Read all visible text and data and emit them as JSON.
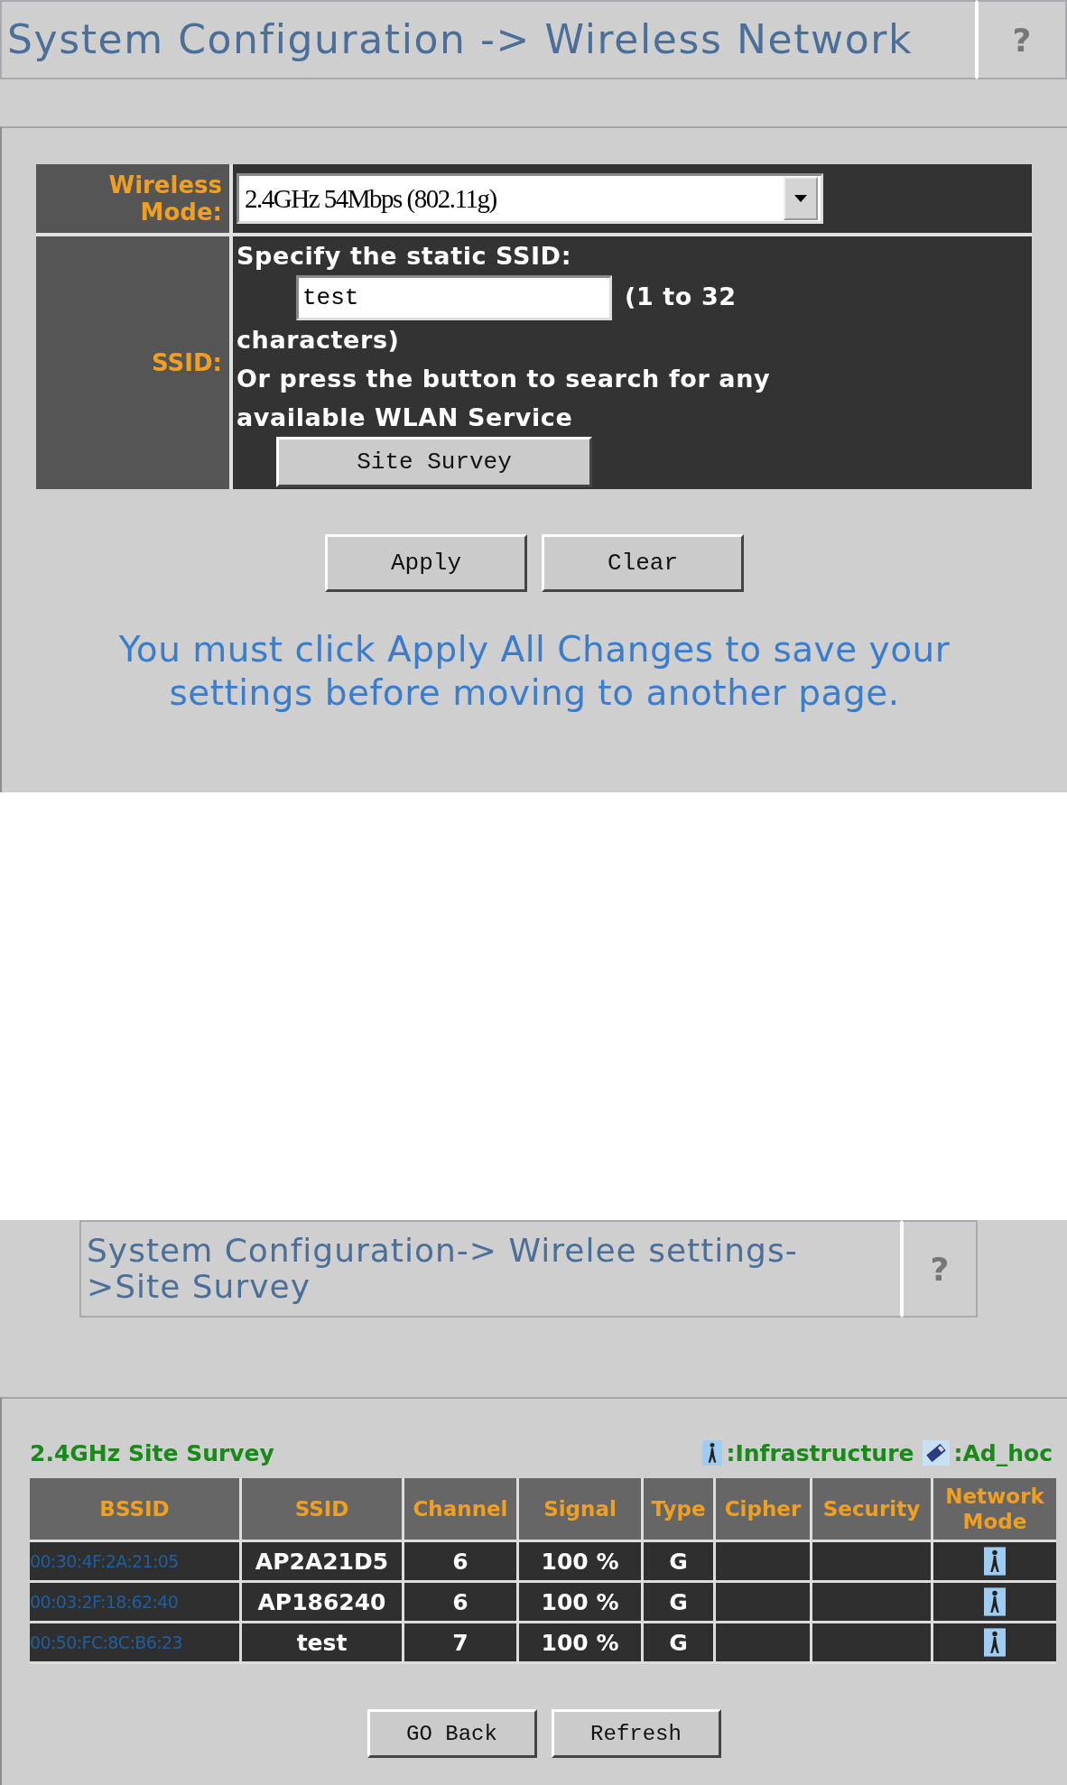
{
  "page_1": {
    "title": "System Configuration -> Wireless Network",
    "help": "?",
    "wireless_mode": {
      "label_lines": [
        "Wireless",
        "Mode:"
      ],
      "value": "2.4GHz 54Mbps (802.11g)"
    },
    "ssid": {
      "label": "SSID:",
      "prompt": "Specify the static SSID:",
      "value": "test",
      "hint_lines": [
        "(1 to 32",
        "characters)"
      ],
      "note": "Or press the button to search for any available WLAN Service",
      "button": "Site Survey"
    },
    "buttons": [
      "Apply",
      "Clear"
    ],
    "message": "You must click Apply All Changes to save your settings before moving to another page."
  },
  "page_2": {
    "title": "System Configuration-> Wirelee settings->Site Survey",
    "help": "?",
    "survey_title": "2.4GHz Site Survey",
    "legend": [
      {
        "kind": "infrastructure",
        "label": ":Infrastructure"
      },
      {
        "kind": "adhoc",
        "label": ":Ad_hoc"
      }
    ],
    "table": {
      "columns": [
        "BSSID",
        "SSID",
        "Channel",
        "Signal",
        "Type",
        "Cipher",
        "Security",
        "Network Mode"
      ],
      "rows": [
        {
          "bssid": "00:30:4F:2A:21:05",
          "ssid": "AP2A21D5",
          "channel": "6",
          "signal": "100 %",
          "type": "G",
          "kind": "infrastructure"
        },
        {
          "bssid": "00:03:2F:18:62:40",
          "ssid": "AP186240",
          "channel": "6",
          "signal": "100 %",
          "type": "G",
          "kind": "infrastructure"
        },
        {
          "bssid": "00:50:FC:8C:B6:23",
          "ssid": "test",
          "channel": "7",
          "signal": "100 %",
          "type": "G",
          "kind": "infrastructure"
        }
      ]
    },
    "buttons": [
      "GO Back",
      "Refresh"
    ]
  }
}
